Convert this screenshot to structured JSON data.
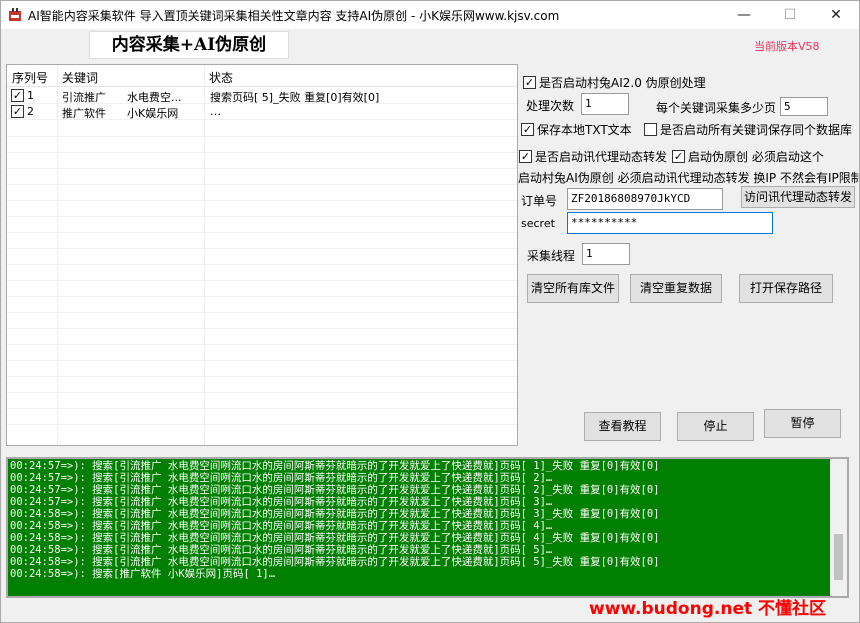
{
  "window": {
    "title": "AI智能内容采集软件 导入置顶关键词采集相关性文章内容 支持AI伪原创 - 小K娱乐网www.kjsv.com",
    "minimize": "—",
    "maximize": "☐",
    "close": "✕"
  },
  "banner": {
    "title": "内容采集+AI伪原创",
    "version": "当前版本V58"
  },
  "list": {
    "headers": {
      "index": "序列号",
      "keyword": "关键词",
      "status": "状态"
    },
    "rows": [
      {
        "checked": "✓",
        "index": "1",
        "keyword": "引流推广",
        "extra": "水电费空...",
        "status": "搜索页码[ 5]_失败 重复[0]有效[0]"
      },
      {
        "checked": "✓",
        "index": "2",
        "keyword": "推广软件",
        "extra": "小K娱乐网",
        "status": "…"
      }
    ]
  },
  "settings": {
    "enable_ai": {
      "checked": "✓",
      "label": "是否启动村兔AI2.0 伪原创处理"
    },
    "process_count_label": "处理次数",
    "process_count": "1",
    "per_keyword_label": "每个关键词采集多少页",
    "per_keyword": "5",
    "save_txt": {
      "checked": "✓",
      "label": "保存本地TXT文本"
    },
    "save_same_db": {
      "checked": "",
      "label": "是否启动所有关键词保存同个数据库"
    },
    "proxy": {
      "checked": "✓",
      "label": "是否启动讯代理动态转发"
    },
    "fake_original": {
      "checked": "✓",
      "label": "启动伪原创 必须启动这个"
    },
    "note": "启动村兔AI伪原创 必须启动讯代理动态转发 换IP 不然会有IP限制",
    "order_label": "订单号",
    "order_value": "ZF20186808970JkYCD",
    "visit_proxy_button": "访问讯代理动态转发",
    "secret_label": "secret",
    "secret_value": "**********",
    "threads_label": "采集线程",
    "threads_value": "1"
  },
  "buttons": {
    "clear_library": "清空所有库文件",
    "clear_duplicates": "清空重复数据",
    "open_save_path": "打开保存路径",
    "tutorial": "查看教程",
    "stop": "停止",
    "pause": "暂停"
  },
  "log": [
    "00:24:57=>): 搜索[引流推广  水电费空间咧流口水的房间阿斯蒂芬就暗示的了开发就爱上了快递费就]页码[ 1]_失败 重复[0]有效[0]",
    "00:24:57=>): 搜索[引流推广  水电费空间咧流口水的房间阿斯蒂芬就暗示的了开发就爱上了快递费就]页码[ 2]…",
    "00:24:57=>): 搜索[引流推广  水电费空间咧流口水的房间阿斯蒂芬就暗示的了开发就爱上了快递费就]页码[ 2]_失败 重复[0]有效[0]",
    "00:24:57=>): 搜索[引流推广  水电费空间咧流口水的房间阿斯蒂芬就暗示的了开发就爱上了快递费就]页码[ 3]…",
    "00:24:58=>): 搜索[引流推广  水电费空间咧流口水的房间阿斯蒂芬就暗示的了开发就爱上了快递费就]页码[ 3]_失败 重复[0]有效[0]",
    "00:24:58=>): 搜索[引流推广  水电费空间咧流口水的房间阿斯蒂芬就暗示的了开发就爱上了快递费就]页码[ 4]…",
    "00:24:58=>): 搜索[引流推广  水电费空间咧流口水的房间阿斯蒂芬就暗示的了开发就爱上了快递费就]页码[ 4]_失败 重复[0]有效[0]",
    "00:24:58=>): 搜索[引流推广  水电费空间咧流口水的房间阿斯蒂芬就暗示的了开发就爱上了快递费就]页码[ 5]…",
    "00:24:58=>): 搜索[引流推广  水电费空间咧流口水的房间阿斯蒂芬就暗示的了开发就爱上了快递费就]页码[ 5]_失败 重复[0]有效[0]",
    "00:24:58=>): 搜索[推广软件  小K娱乐网]页码[ 1]…"
  ],
  "watermark": "www.budong.net 不懂社区"
}
